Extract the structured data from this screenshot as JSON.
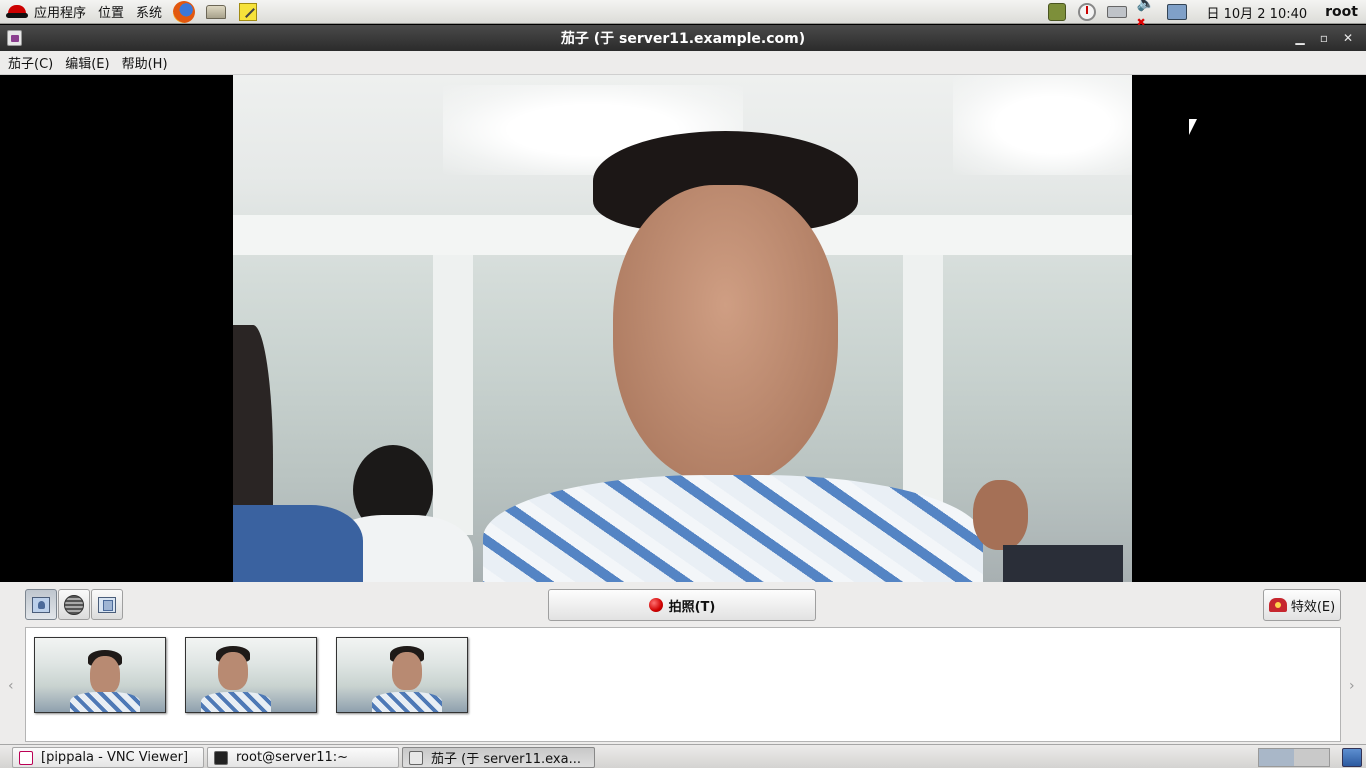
{
  "top_panel": {
    "applications_label": "应用程序",
    "places_label": "位置",
    "system_label": "系统",
    "clock": "日 10月  2 10:40",
    "user": "root"
  },
  "window": {
    "title": "茄子 (于 server11.example.com)"
  },
  "menubar": {
    "items": [
      "茄子(C)",
      "编辑(E)",
      "帮助(H)"
    ]
  },
  "toolbar": {
    "take_photo_label": "拍照(T)",
    "effects_label": "特效(E)",
    "mode_buttons": [
      "photo-mode",
      "video-mode",
      "burst-mode"
    ],
    "active_mode": "photo-mode"
  },
  "thumbnails": {
    "count": 3,
    "scroll_left": "‹",
    "scroll_right": "›"
  },
  "taskbar": {
    "tasks": [
      {
        "label": "[pippala - VNC Viewer]",
        "active": false
      },
      {
        "label": "root@server11:~",
        "active": false
      },
      {
        "label": "茄子 (于 server11.exa...",
        "active": true
      }
    ]
  },
  "colors": {
    "titlebar": "#2b2b2b",
    "record_button": "#d00000",
    "active_workspace": "#a9b7c8"
  }
}
